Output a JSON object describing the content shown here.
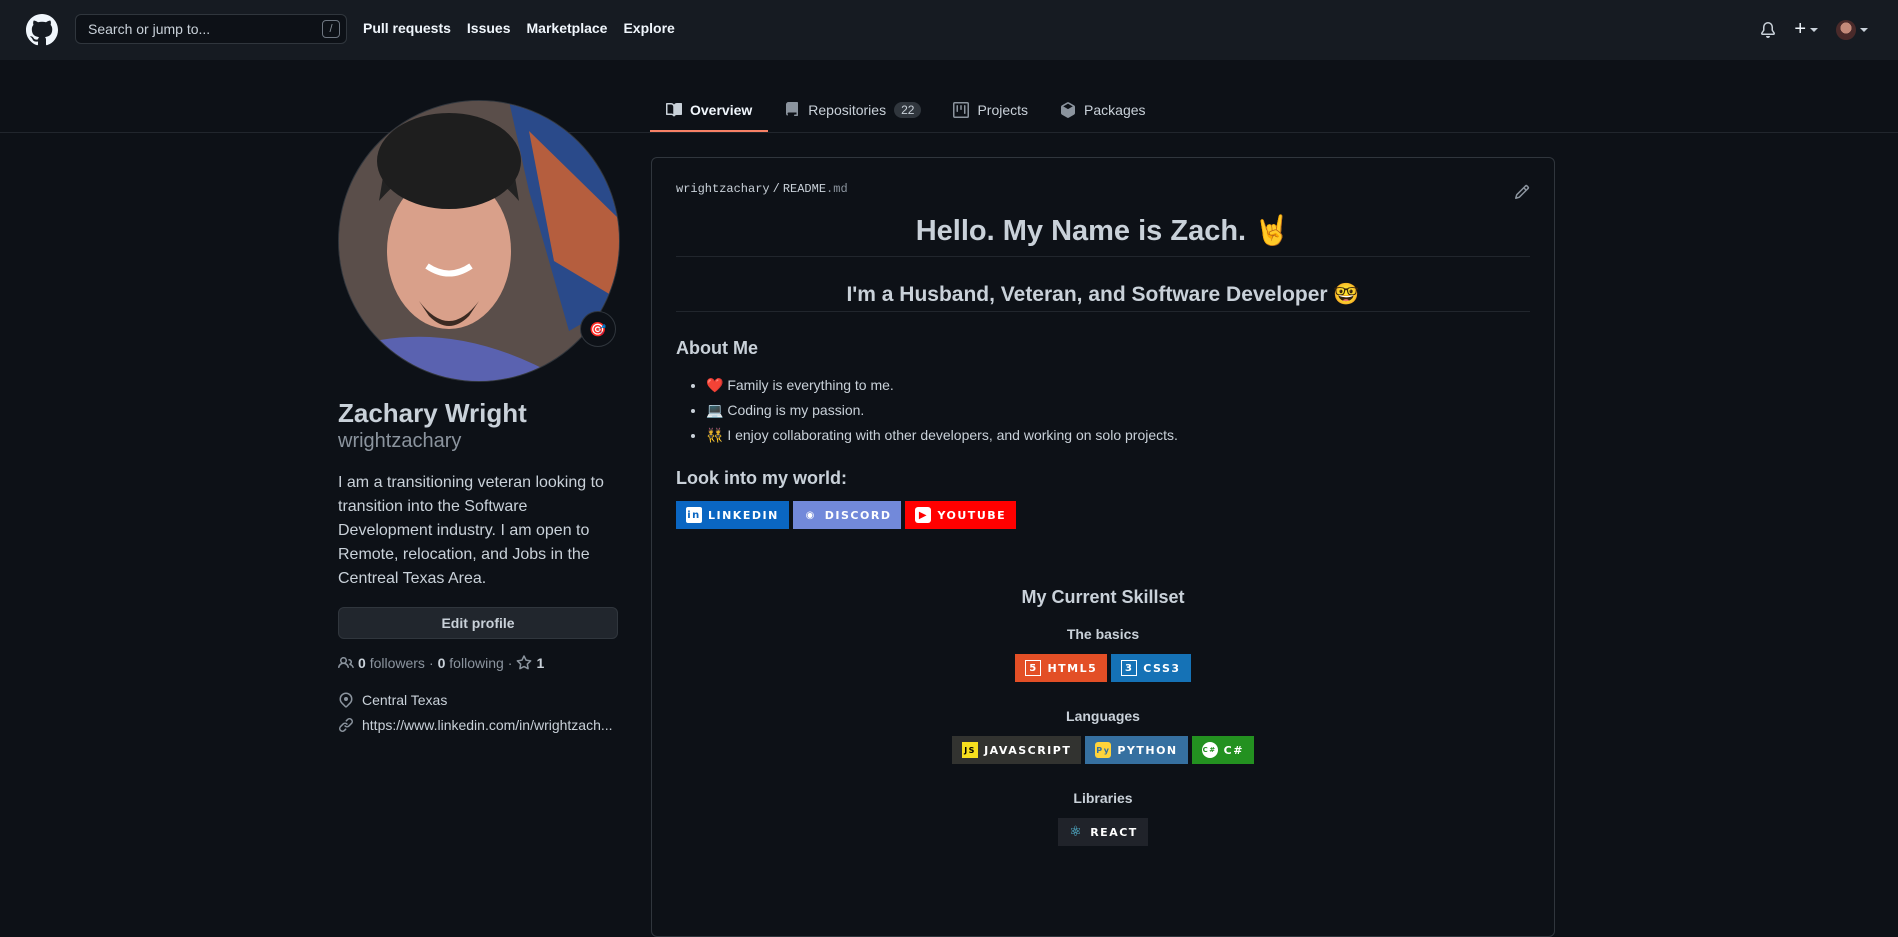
{
  "header": {
    "search_placeholder": "Search or jump to...",
    "search_shortcut": "/",
    "nav": [
      "Pull requests",
      "Issues",
      "Marketplace",
      "Explore"
    ],
    "plus_label": "+"
  },
  "tabs": [
    {
      "label": "Overview",
      "icon": "book-icon"
    },
    {
      "label": "Repositories",
      "icon": "repo-icon",
      "count": "22"
    },
    {
      "label": "Projects",
      "icon": "project-icon"
    },
    {
      "label": "Packages",
      "icon": "package-icon"
    }
  ],
  "profile": {
    "name": "Zachary Wright",
    "login": "wrightzachary",
    "status_emoji": "🎯",
    "bio": "I am a transitioning veteran looking to transition into the Software Development industry. I am open to Remote, relocation, and Jobs in the Centreal Texas Area.",
    "edit_label": "Edit profile",
    "followers_count": "0",
    "followers_label": "followers",
    "separator": "·",
    "following_count": "0",
    "following_label": "following",
    "stars_count": "1",
    "location": "Central Texas",
    "website": "https://www.linkedin.com/in/wrightzach..."
  },
  "readme": {
    "owner": "wrightzachary",
    "slash": "/",
    "file_base": "README",
    "file_ext": ".md",
    "title": "Hello. My Name is Zach. 🤘",
    "subtitle": "I'm a Husband, Veteran, and Software Developer 🤓",
    "about_heading": "About Me",
    "about_items": [
      {
        "emoji": "❤️",
        "text": "Family is everything to me."
      },
      {
        "emoji": "💻",
        "text": "Coding is my passion."
      },
      {
        "emoji": "👯",
        "text": "I enjoy collaborating with other developers, and working on solo projects."
      }
    ],
    "world_heading": "Look into my world:",
    "social_badges": [
      {
        "label": "LINKEDIN",
        "color": "#0a66c2",
        "icon": "in"
      },
      {
        "label": "DISCORD",
        "color": "#7289da",
        "icon": "◉"
      },
      {
        "label": "YOUTUBE",
        "color": "#ff0000",
        "icon": "▶"
      }
    ],
    "skills_heading": "My Current Skillset",
    "basics_heading": "The basics",
    "basics_badges": [
      {
        "label": "HTML5",
        "color": "#e34f26",
        "icon": "5"
      },
      {
        "label": "CSS3",
        "color": "#1572b6",
        "icon": "3"
      }
    ],
    "languages_heading": "Languages",
    "language_badges": [
      {
        "label": "JAVASCRIPT",
        "color": "#323330",
        "icon": "JS"
      },
      {
        "label": "PYTHON",
        "color": "#3670a0",
        "icon": "Py"
      },
      {
        "label": "C#",
        "color": "#239120",
        "icon": "C#"
      }
    ],
    "libraries_heading": "Libraries",
    "library_badges": [
      {
        "label": "REACT",
        "color": "#20232a",
        "icon": "⚛"
      }
    ]
  },
  "colors": {
    "accent": "#f78166",
    "background": "#0d1117",
    "header": "#161b22"
  }
}
